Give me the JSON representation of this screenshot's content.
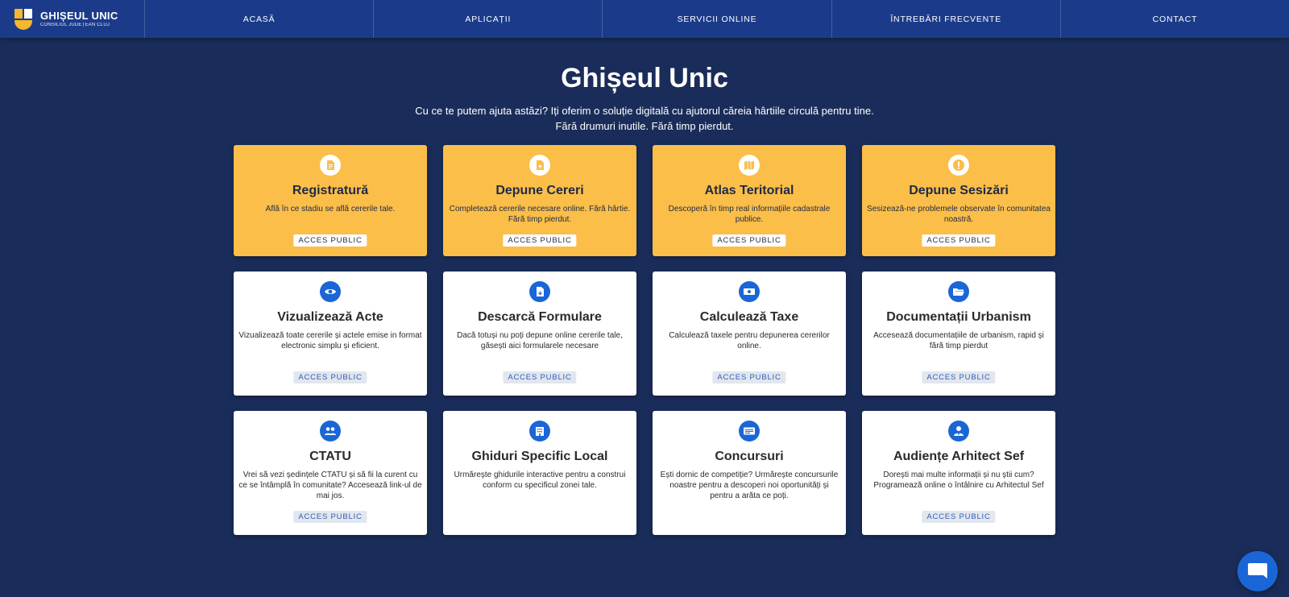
{
  "header": {
    "logo_title": "GHIȘEUL UNIC",
    "logo_subtitle": "CONSILIUL JUDEȚEAN CLUJ",
    "nav": [
      {
        "label": "ACASĂ"
      },
      {
        "label": "APLICAȚII"
      },
      {
        "label": "SERVICII ONLINE"
      },
      {
        "label": "ÎNTREBĂRI FRECVENTE"
      },
      {
        "label": "CONTACT"
      }
    ]
  },
  "hero": {
    "title": "Ghișeul Unic",
    "subtitle_line1": "Cu ce te putem ajuta astăzi? Iți oferim o soluție digitală cu ajutorul căreia hârtiile circulă pentru tine.",
    "subtitle_line2": "Fără drumuri inutile. Fără timp pierdut."
  },
  "cards": [
    {
      "title": "Registratură",
      "desc": "Află în ce stadiu se află cererile tale.",
      "badge": "ACCES PUBLIC",
      "icon": "document-icon"
    },
    {
      "title": "Depune Cereri",
      "desc": "Completează cererile necesare online. Fără hârtie. Fără timp pierdut.",
      "badge": "ACCES PUBLIC",
      "icon": "file-upload-icon"
    },
    {
      "title": "Atlas Teritorial",
      "desc": "Descoperă în timp real informațiile cadastrale publice.",
      "badge": "ACCES PUBLIC",
      "icon": "map-icon"
    },
    {
      "title": "Depune Sesizări",
      "desc": "Sesizează-ne problemele observate în comunitatea noastră.",
      "badge": "ACCES PUBLIC",
      "icon": "alert-icon"
    },
    {
      "title": "Vizualizează Acte",
      "desc": "Vizualizează toate cererile și actele emise in format electronic simplu și eficient.",
      "badge": "ACCES PUBLIC",
      "icon": "eye-icon"
    },
    {
      "title": "Descarcă Formulare",
      "desc": "Dacă totuși nu poți depune online cererile tale, găsești aici formularele necesare",
      "badge": "ACCES PUBLIC",
      "icon": "file-download-icon"
    },
    {
      "title": "Calculează Taxe",
      "desc": "Calculează taxele pentru depunerea cererilor online.",
      "badge": "ACCES PUBLIC",
      "icon": "money-icon"
    },
    {
      "title": "Documentații Urbanism",
      "desc": "Accesează documentațiile de urbanism, rapid și fără timp pierdut",
      "badge": "ACCES PUBLIC",
      "icon": "folder-open-icon"
    },
    {
      "title": "CTATU",
      "desc": "Vrei să vezi ședințele CTATU și să fii la curent cu ce se întâmplă în comunitate? Accesează link-ul de mai jos.",
      "badge": "ACCES PUBLIC",
      "icon": "users-icon"
    },
    {
      "title": "Ghiduri Specific Local",
      "desc": "Urmărește ghidurile interactive pentru a construi conform cu specificul zonei tale.",
      "badge": "",
      "icon": "building-icon"
    },
    {
      "title": "Concursuri",
      "desc": "Ești dornic de competiție? Urmărește concursurile noastre pentru a descoperi noi oportunități și pentru a arăta ce poți.",
      "badge": "",
      "icon": "id-card-icon"
    },
    {
      "title": "Audiențe Arhitect Sef",
      "desc": "Dorești mai multe informații și nu știi cum? Programează online o întâlnire cu Arhitectul Sef",
      "badge": "ACCES PUBLIC",
      "icon": "user-tie-icon"
    }
  ],
  "colors": {
    "background": "#1a2d5a",
    "header": "#1b3b8a",
    "card_yellow": "#fbbe49",
    "icon_blue": "#1a66d6"
  }
}
